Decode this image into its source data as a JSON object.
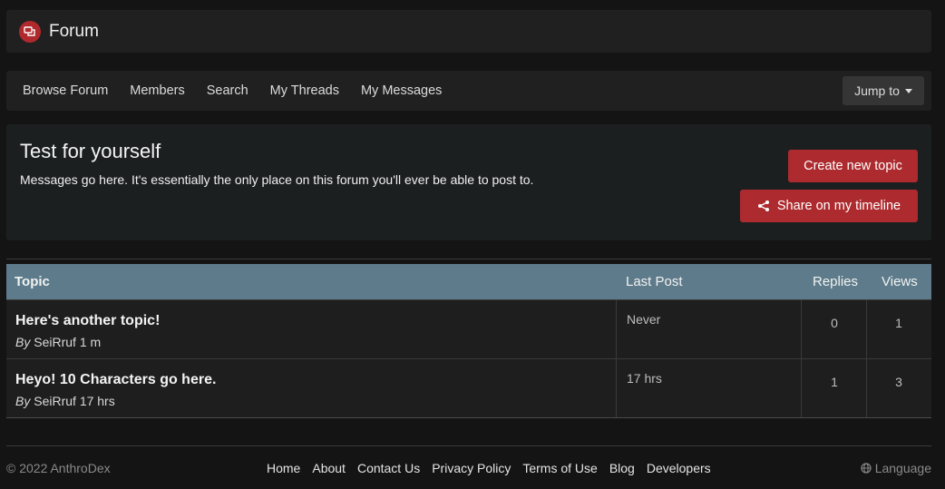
{
  "header": {
    "title": "Forum"
  },
  "nav": {
    "items": [
      "Browse Forum",
      "Members",
      "Search",
      "My Threads",
      "My Messages"
    ],
    "jump_label": "Jump to"
  },
  "intro": {
    "title": "Test for yourself",
    "description": "Messages go here. It's essentially the only place on this forum you'll ever be able to post to.",
    "create_label": "Create new topic",
    "share_label": "Share on my timeline"
  },
  "table": {
    "headers": {
      "topic": "Topic",
      "last_post": "Last Post",
      "replies": "Replies",
      "views": "Views"
    },
    "rows": [
      {
        "title": "Here's another topic!",
        "by": "By",
        "author": "SeiRruf",
        "age": "1 m",
        "last_post": "Never",
        "replies": "0",
        "views": "1"
      },
      {
        "title": "Heyo! 10 Characters go here.",
        "by": "By",
        "author": "SeiRruf",
        "age": "17 hrs",
        "last_post": "17 hrs",
        "replies": "1",
        "views": "3"
      }
    ]
  },
  "footer": {
    "copyright": "© 2022 AnthroDex",
    "links": [
      "Home",
      "About",
      "Contact Us",
      "Privacy Policy",
      "Terms of Use",
      "Blog",
      "Developers"
    ],
    "language": "Language"
  },
  "colors": {
    "accent": "#ad2a2e",
    "table_header": "#5d7b8a",
    "background": "#141414"
  },
  "icons": {
    "logo": "chat-bubbles-icon",
    "share": "share-icon",
    "globe": "globe-icon",
    "caret": "caret-down-icon"
  }
}
